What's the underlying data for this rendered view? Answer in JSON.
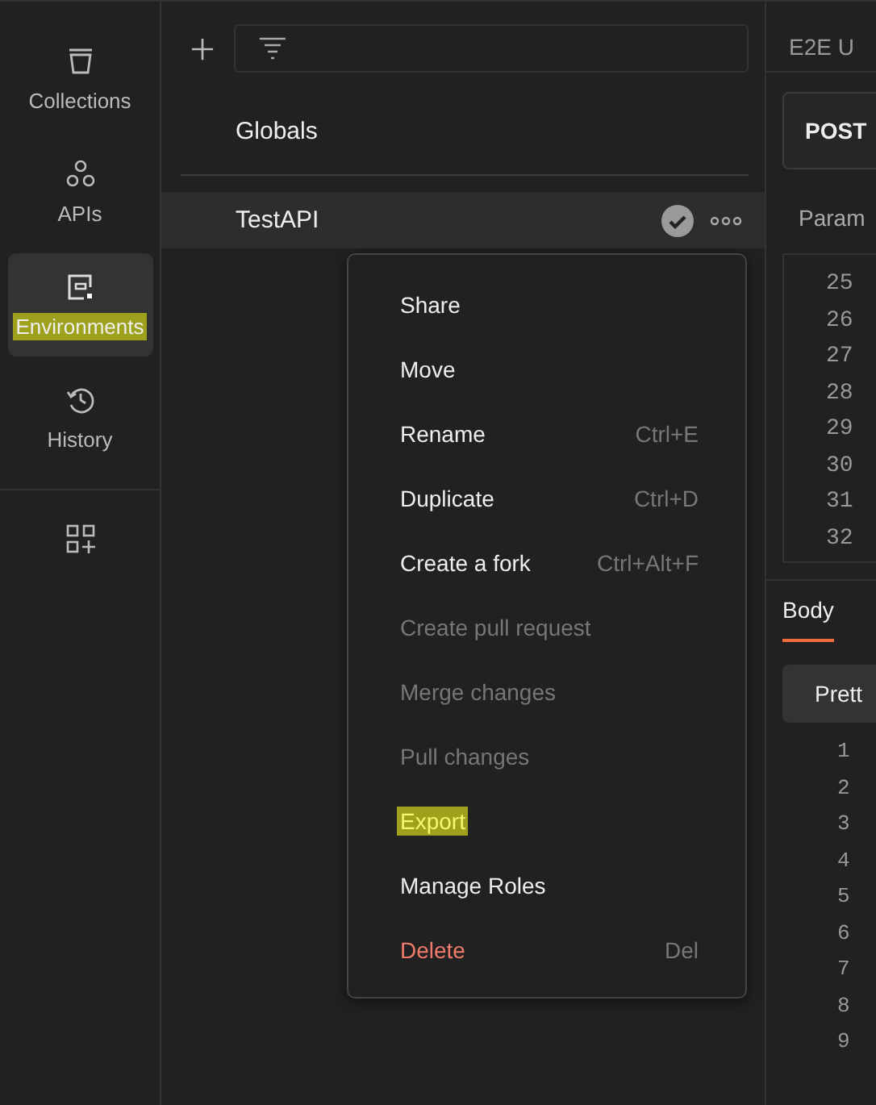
{
  "sidebar": {
    "items": [
      {
        "label": "Collections",
        "kind": "collections",
        "selected": false,
        "highlighted": false
      },
      {
        "label": "APIs",
        "kind": "apis",
        "selected": false,
        "highlighted": false
      },
      {
        "label": "Environments",
        "kind": "environments",
        "selected": true,
        "highlighted": true
      },
      {
        "label": "History",
        "kind": "history",
        "selected": false,
        "highlighted": false
      }
    ]
  },
  "environments": {
    "items": [
      {
        "label": "Globals",
        "selected": false,
        "active": false
      },
      {
        "label": "TestAPI",
        "selected": true,
        "active": true
      }
    ]
  },
  "context_menu": {
    "items": [
      {
        "label": "Share",
        "disabled": false,
        "kind": "action",
        "highlighted": false
      },
      {
        "label": "Move",
        "disabled": false,
        "kind": "action",
        "highlighted": false
      },
      {
        "label": "Rename",
        "shortcut": "Ctrl+E",
        "disabled": false,
        "kind": "action",
        "highlighted": false
      },
      {
        "label": "Duplicate",
        "shortcut": "Ctrl+D",
        "disabled": false,
        "kind": "action",
        "highlighted": false
      },
      {
        "label": "Create a fork",
        "shortcut": "Ctrl+Alt+F",
        "disabled": false,
        "kind": "action",
        "highlighted": false
      },
      {
        "label": "Create pull request",
        "disabled": true,
        "kind": "action",
        "highlighted": false
      },
      {
        "label": "Merge changes",
        "disabled": true,
        "kind": "action",
        "highlighted": false
      },
      {
        "label": "Pull changes",
        "disabled": true,
        "kind": "action",
        "highlighted": false
      },
      {
        "label": "Export",
        "disabled": false,
        "kind": "action",
        "highlighted": true
      },
      {
        "label": "Manage Roles",
        "disabled": false,
        "kind": "action",
        "highlighted": false
      },
      {
        "label": "Delete",
        "shortcut": "Del",
        "disabled": false,
        "kind": "danger",
        "highlighted": false
      }
    ]
  },
  "request": {
    "tab": "E2E U",
    "method": "POST",
    "params_tab": "Param",
    "editor_lines": [
      "25",
      "26",
      "27",
      "28",
      "29",
      "30",
      "31",
      "32"
    ],
    "response_tabs": [
      {
        "label": "Body",
        "selected": true
      }
    ],
    "view_mode": "Prett",
    "response_lines": [
      "1",
      "2",
      "3",
      "4",
      "5",
      "6",
      "7",
      "8",
      "9"
    ]
  }
}
